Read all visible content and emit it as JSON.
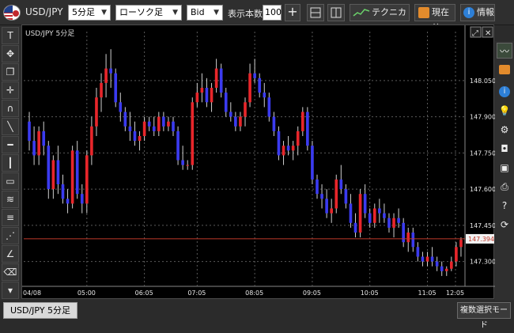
{
  "header": {
    "symbol": "USD/JPY",
    "timeframe": "5分足",
    "chart_style": "ローソク足",
    "price_type": "Bid",
    "bars_label": "表示本数",
    "bars_value": "100",
    "technical_label": "テクニカル",
    "current_price_label": "現在値",
    "info_label": "情報"
  },
  "chart": {
    "title": "USD/JPY 5分足",
    "current_price": "147.394"
  },
  "footer": {
    "tab_label": "USD/JPY 5分足",
    "multi_select_label": "複数選択モード"
  },
  "colors": {
    "up": "#e8262b",
    "down": "#3b3bf0",
    "price_line": "#c0392b",
    "background": "#000000",
    "grid": "#5a5a5a"
  },
  "chart_data": {
    "type": "candlestick",
    "x_ticks": [
      "04/08",
      "05:00",
      "06:05",
      "07:05",
      "08:05",
      "09:05",
      "10:05",
      "11:05",
      "12:05"
    ],
    "y_ticks": [
      "148.050",
      "147.900",
      "147.750",
      "147.600",
      "147.450",
      "147.300"
    ],
    "ylim": [
      147.22,
      148.22
    ],
    "candles": [
      [
        147.88,
        147.92,
        147.76,
        147.8
      ],
      [
        147.8,
        147.86,
        147.7,
        147.74
      ],
      [
        147.74,
        147.86,
        147.7,
        147.84
      ],
      [
        147.84,
        147.88,
        147.74,
        147.78
      ],
      [
        147.78,
        147.8,
        147.56,
        147.6
      ],
      [
        147.6,
        147.74,
        147.56,
        147.72
      ],
      [
        147.72,
        147.78,
        147.58,
        147.62
      ],
      [
        147.62,
        147.66,
        147.54,
        147.56
      ],
      [
        147.56,
        147.6,
        147.5,
        147.54
      ],
      [
        147.54,
        147.78,
        147.52,
        147.76
      ],
      [
        147.76,
        147.8,
        147.56,
        147.58
      ],
      [
        147.58,
        147.62,
        147.5,
        147.54
      ],
      [
        147.54,
        147.76,
        147.5,
        147.74
      ],
      [
        147.74,
        147.9,
        147.7,
        147.86
      ],
      [
        147.86,
        148.02,
        147.82,
        147.98
      ],
      [
        147.98,
        148.08,
        147.92,
        148.04
      ],
      [
        148.04,
        148.16,
        147.98,
        148.1
      ],
      [
        148.1,
        148.18,
        148.02,
        148.08
      ],
      [
        148.08,
        148.1,
        147.94,
        147.96
      ],
      [
        147.96,
        148.0,
        147.88,
        147.92
      ],
      [
        147.92,
        147.94,
        147.84,
        147.86
      ],
      [
        147.86,
        147.92,
        147.8,
        147.84
      ],
      [
        147.84,
        147.88,
        147.78,
        147.8
      ],
      [
        147.8,
        147.84,
        147.76,
        147.82
      ],
      [
        147.82,
        147.9,
        147.8,
        147.88
      ],
      [
        147.88,
        147.9,
        147.84,
        147.86
      ],
      [
        147.86,
        147.9,
        147.82,
        147.84
      ],
      [
        147.84,
        147.92,
        147.82,
        147.9
      ],
      [
        147.9,
        147.92,
        147.84,
        147.86
      ],
      [
        147.86,
        147.9,
        147.84,
        147.88
      ],
      [
        147.88,
        147.9,
        147.82,
        147.84
      ],
      [
        147.84,
        147.86,
        147.7,
        147.72
      ],
      [
        147.72,
        147.78,
        147.68,
        147.7
      ],
      [
        147.7,
        147.72,
        147.68,
        147.7
      ],
      [
        147.7,
        147.98,
        147.68,
        147.96
      ],
      [
        147.96,
        148.04,
        147.94,
        148.0
      ],
      [
        148.0,
        148.08,
        147.96,
        148.02
      ],
      [
        148.02,
        148.06,
        147.94,
        147.96
      ],
      [
        147.96,
        148.04,
        147.92,
        148.02
      ],
      [
        148.02,
        148.14,
        148.0,
        148.1
      ],
      [
        148.1,
        148.12,
        147.98,
        148.0
      ],
      [
        148.0,
        148.02,
        147.9,
        147.92
      ],
      [
        147.92,
        147.96,
        147.88,
        147.9
      ],
      [
        147.9,
        147.92,
        147.84,
        147.86
      ],
      [
        147.86,
        147.92,
        147.84,
        147.9
      ],
      [
        147.9,
        147.98,
        147.86,
        147.96
      ],
      [
        147.96,
        148.12,
        147.94,
        148.08
      ],
      [
        148.08,
        148.14,
        148.04,
        148.06
      ],
      [
        148.06,
        148.08,
        147.98,
        148.0
      ],
      [
        148.0,
        148.04,
        147.94,
        147.98
      ],
      [
        147.98,
        148.0,
        147.88,
        147.9
      ],
      [
        147.9,
        147.92,
        147.82,
        147.84
      ],
      [
        147.84,
        147.86,
        147.72,
        147.74
      ],
      [
        147.74,
        147.8,
        147.7,
        147.78
      ],
      [
        147.78,
        147.82,
        147.74,
        147.76
      ],
      [
        147.76,
        147.8,
        147.72,
        147.78
      ],
      [
        147.78,
        147.86,
        147.74,
        147.84
      ],
      [
        147.84,
        147.94,
        147.82,
        147.92
      ],
      [
        147.92,
        147.94,
        147.76,
        147.78
      ],
      [
        147.78,
        147.8,
        147.62,
        147.64
      ],
      [
        147.64,
        147.66,
        147.56,
        147.58
      ],
      [
        147.58,
        147.62,
        147.52,
        147.56
      ],
      [
        147.56,
        147.6,
        147.48,
        147.5
      ],
      [
        147.5,
        147.56,
        147.46,
        147.52
      ],
      [
        147.52,
        147.66,
        147.5,
        147.64
      ],
      [
        147.64,
        147.7,
        147.58,
        147.6
      ],
      [
        147.6,
        147.62,
        147.52,
        147.54
      ],
      [
        147.54,
        147.58,
        147.44,
        147.46
      ],
      [
        147.46,
        147.5,
        147.4,
        147.42
      ],
      [
        147.42,
        147.6,
        147.4,
        147.58
      ],
      [
        147.58,
        147.62,
        147.48,
        147.5
      ],
      [
        147.5,
        147.52,
        147.44,
        147.46
      ],
      [
        147.46,
        147.54,
        147.44,
        147.52
      ],
      [
        147.52,
        147.56,
        147.46,
        147.5
      ],
      [
        147.5,
        147.54,
        147.46,
        147.48
      ],
      [
        147.48,
        147.5,
        147.42,
        147.44
      ],
      [
        147.44,
        147.5,
        147.4,
        147.48
      ],
      [
        147.48,
        147.52,
        147.44,
        147.46
      ],
      [
        147.46,
        147.48,
        147.36,
        147.38
      ],
      [
        147.38,
        147.44,
        147.34,
        147.42
      ],
      [
        147.42,
        147.44,
        147.34,
        147.36
      ],
      [
        147.36,
        147.38,
        147.3,
        147.32
      ],
      [
        147.32,
        147.34,
        147.28,
        147.3
      ],
      [
        147.3,
        147.34,
        147.28,
        147.32
      ],
      [
        147.32,
        147.36,
        147.28,
        147.3
      ],
      [
        147.3,
        147.32,
        147.26,
        147.28
      ],
      [
        147.28,
        147.3,
        147.24,
        147.26
      ],
      [
        147.26,
        147.28,
        147.24,
        147.27
      ],
      [
        147.27,
        147.32,
        147.26,
        147.3
      ],
      [
        147.3,
        147.38,
        147.28,
        147.36
      ],
      [
        147.36,
        147.4,
        147.32,
        147.39
      ]
    ]
  }
}
